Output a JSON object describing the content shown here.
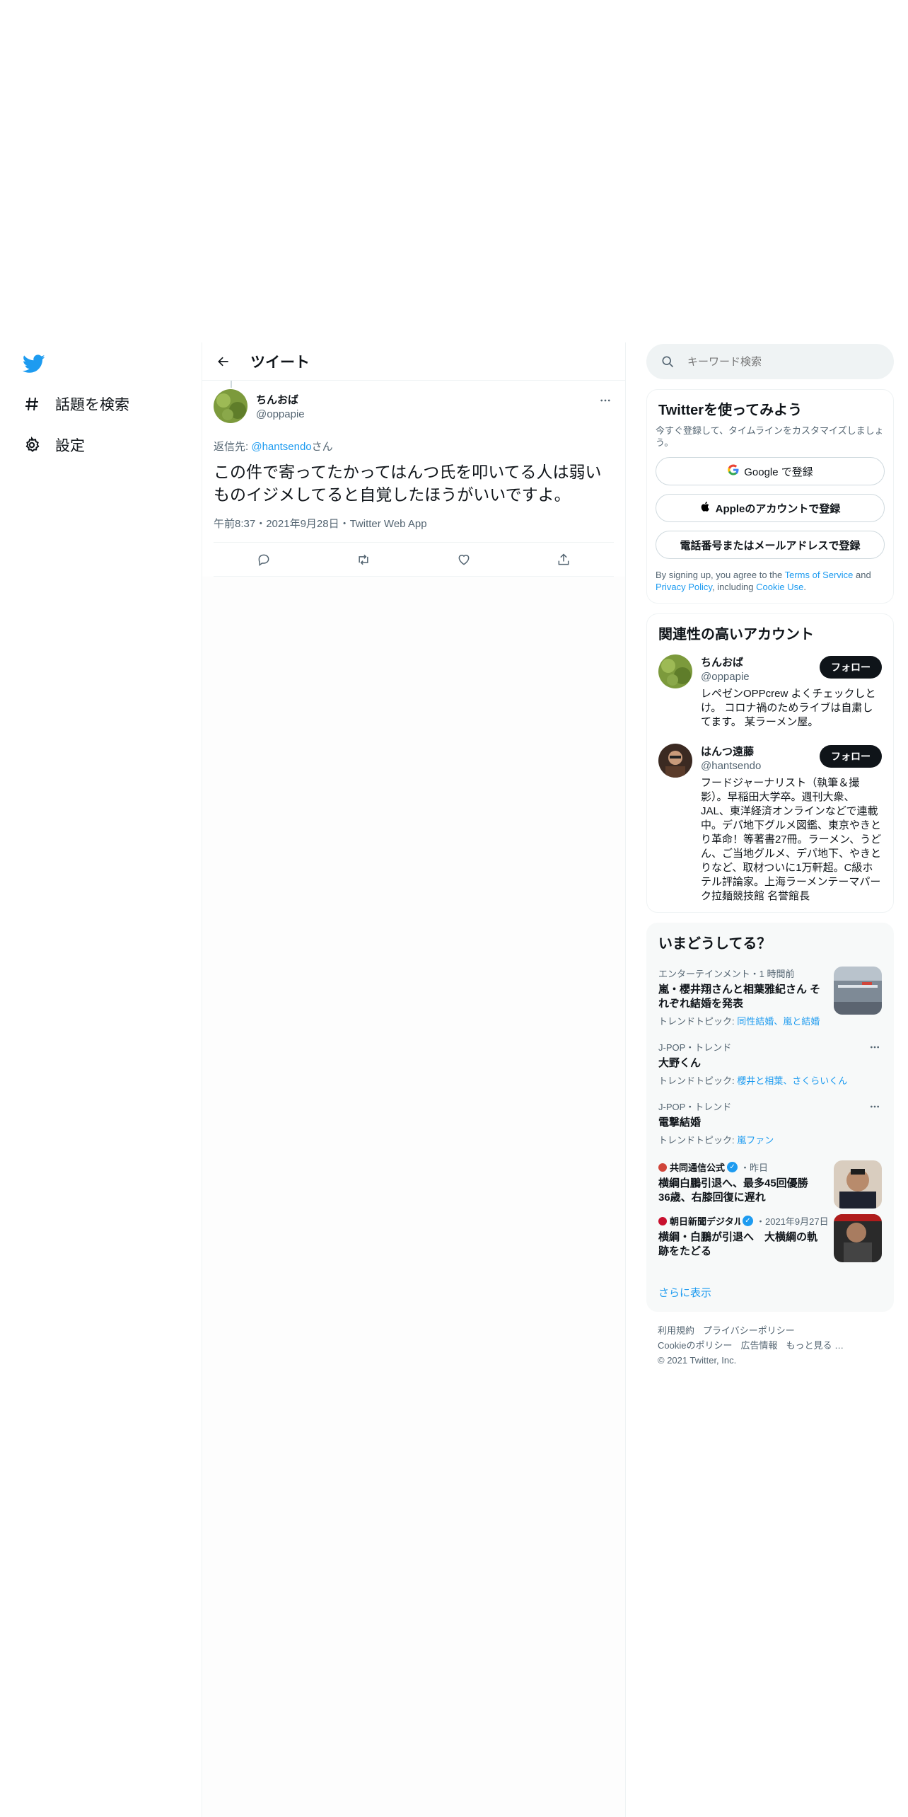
{
  "nav": {
    "logo": "twitter-bird-icon",
    "explore_label": "話題を検索",
    "settings_label": "設定"
  },
  "header": {
    "title": "ツイート"
  },
  "tweet": {
    "author_name": "ちんおば",
    "author_handle": "@oppapie",
    "reply_prefix": "返信先: ",
    "reply_handle": "@hantsendo",
    "reply_suffix": "さん",
    "text": "この件で寄ってたかってはんつ氏を叩いてる人は弱いものイジメしてると自覚したほうがいいですよ。",
    "meta": "午前8:37・2021年9月28日・Twitter Web App"
  },
  "search": {
    "placeholder": "キーワード検索"
  },
  "signup": {
    "title": "Twitterを使ってみよう",
    "subtitle": "今すぐ登録して、タイムラインをカスタマイズしましょう。",
    "google_label": "Google で登録",
    "apple_label": "Appleのアカウントで登録",
    "phone_label": "電話番号またはメールアドレスで登録",
    "terms_1": "By signing up, you agree to the ",
    "terms_tos": "Terms of Service",
    "terms_2": " and ",
    "terms_privacy": "Privacy Policy",
    "terms_3": ", including ",
    "terms_cookie": "Cookie Use",
    "terms_4": "."
  },
  "who": {
    "title": "関連性の高いアカウント",
    "follow_label": "フォロー",
    "accounts": [
      {
        "name": "ちんおば",
        "handle": "@oppapie",
        "bio": "レペゼンOPPcrew よくチェックしとけ。 コロナ禍のためライブは自粛してます。 某ラーメン屋。"
      },
      {
        "name": "はんつ遠藤",
        "handle": "@hantsendo",
        "bio": "フードジャーナリスト（執筆＆撮影）。早稲田大学卒。週刊大衆、JAL、東洋経済オンラインなどで連載中。デパ地下グルメ図鑑、東京やきとり革命！等著書27冊。ラーメン、うどん、ご当地グルメ、デパ地下、やきとりなど、取材ついに1万軒超。C級ホテル評論家。上海ラーメンテーマパーク拉麺競技館 名誉館長"
      }
    ]
  },
  "trends": {
    "title": "いまどうしてる？",
    "items": [
      {
        "meta": "エンターテインメント・1 時間前",
        "title": "嵐・櫻井翔さんと相葉雅紀さん それぞれ結婚を発表",
        "topics_label": "トレンドトピック: ",
        "topics": "同性結婚、嵐と結婚"
      },
      {
        "meta": "J-POP・トレンド",
        "title": "大野くん",
        "topics_label": "トレンドトピック: ",
        "topics": "櫻井と相葉、さくらいくん"
      },
      {
        "meta": "J-POP・トレンド",
        "title": "電撃結婚",
        "topics_label": "トレンドトピック: ",
        "topics": "嵐ファン"
      },
      {
        "source": "共同通信公式",
        "meta": "・昨日",
        "title": "横綱白鵬引退へ、最多45回優勝 36歳、右膝回復に遅れ"
      },
      {
        "source": "朝日新聞デジタル",
        "meta": "・2021年9月27日",
        "title": "横綱・白鵬が引退へ　大横綱の軌跡をたどる"
      }
    ],
    "show_more": "さらに表示"
  },
  "footer": {
    "terms": "利用規約",
    "privacy": "プライバシーポリシー",
    "cookie": "Cookieのポリシー",
    "ads": "広告情報",
    "more": "もっと見る …",
    "copyright": "© 2021 Twitter, Inc."
  },
  "colors": {
    "accent": "#1d9bf0",
    "text": "#0f1419",
    "secondary": "#536471"
  }
}
